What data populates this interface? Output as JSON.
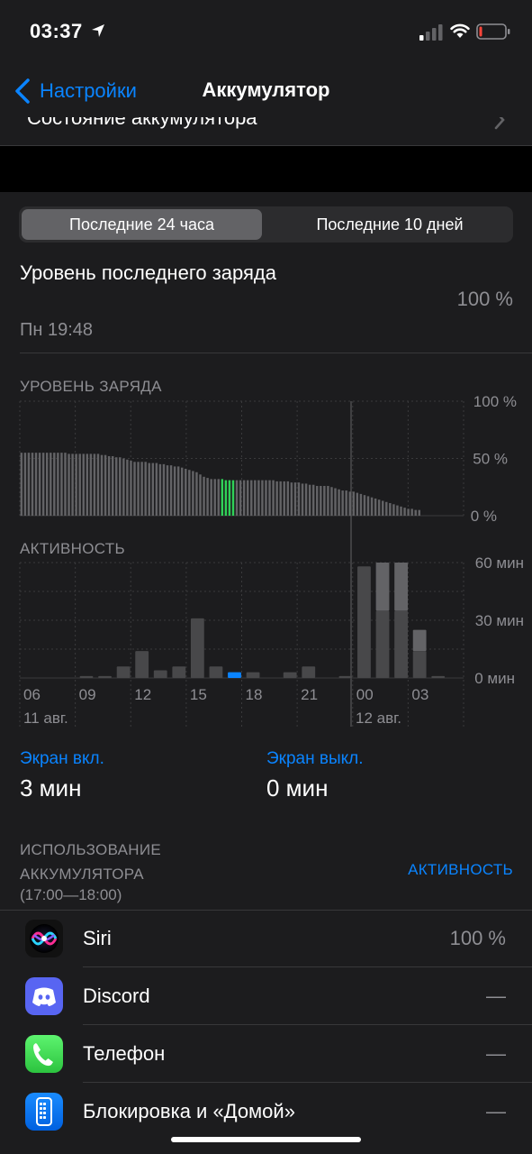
{
  "status_bar": {
    "time": "03:37",
    "location_icon": "location-arrow-icon",
    "signal_icon": "cellular-signal-icon",
    "wifi_icon": "wifi-icon",
    "battery_icon": "battery-low-icon",
    "battery_color": "#ff453a"
  },
  "nav": {
    "back_label": "Настройки",
    "title": "Аккумулятор",
    "accent": "#0a84ff"
  },
  "previous_row": {
    "label": "Состояние аккумулятора"
  },
  "segmented": {
    "options": [
      "Последние 24 часа",
      "Последние 10 дней"
    ],
    "selected": "Последние 24 часа"
  },
  "last_charge": {
    "title": "Уровень последнего заряда",
    "time": "Пн 19:48",
    "value": "100 %"
  },
  "battery_level": {
    "label": "УРОВЕНЬ ЗАРЯДА",
    "y_ticks": [
      "100 %",
      "50 %",
      "0 %"
    ]
  },
  "activity": {
    "label": "АКТИВНОСТЬ",
    "y_ticks": [
      "60 мин",
      "30 мин",
      "0 мин"
    ],
    "x_ticks": [
      "06",
      "09",
      "12",
      "15",
      "18",
      "21",
      "00",
      "03"
    ],
    "date_labels": [
      "11 авг.",
      "12 авг."
    ]
  },
  "chart_data": [
    {
      "type": "bar",
      "title": "УРОВЕНЬ ЗАРЯДА",
      "ylabel": "",
      "ylim": [
        0,
        100
      ],
      "y_ticks": [
        "100 %",
        "50 %",
        "0 %"
      ],
      "x_ticks": [
        "06",
        "09",
        "12",
        "15",
        "18",
        "21",
        "00",
        "03"
      ],
      "highlight_color": "#30d158",
      "bar_color": "#636366",
      "values": [
        55,
        55,
        55,
        55,
        55,
        55,
        55,
        55,
        55,
        55,
        55,
        55,
        55,
        54,
        54,
        54,
        54,
        54,
        54,
        54,
        54,
        54,
        53,
        53,
        52,
        52,
        51,
        51,
        50,
        49,
        48,
        47,
        47,
        47,
        47,
        46,
        46,
        46,
        45,
        45,
        44,
        44,
        43,
        43,
        42,
        41,
        40,
        39,
        38,
        36,
        34,
        33,
        32,
        32,
        32,
        32,
        31,
        31,
        31,
        31,
        31,
        31,
        31,
        31,
        31,
        31,
        31,
        31,
        31,
        31,
        30,
        30,
        30,
        30,
        29,
        29,
        29,
        28,
        28,
        27,
        27,
        26,
        26,
        26,
        26,
        25,
        24,
        23,
        22,
        22,
        21,
        21,
        20,
        19,
        18,
        17,
        16,
        15,
        14,
        13,
        12,
        11,
        10,
        9,
        8,
        7,
        6,
        6,
        5,
        5
      ],
      "highlight_range": [
        55,
        58
      ]
    },
    {
      "type": "bar",
      "title": "АКТИВНОСТЬ",
      "ylabel": "",
      "ylim": [
        0,
        60
      ],
      "y_ticks": [
        "60 мин",
        "30 мин",
        "0 мин"
      ],
      "x_ticks": [
        "06",
        "09",
        "12",
        "15",
        "18",
        "21",
        "00",
        "03"
      ],
      "date_labels": [
        "11 авг.",
        "12 авг."
      ],
      "categories": [
        "05",
        "06",
        "07",
        "08",
        "09",
        "10",
        "11",
        "12",
        "13",
        "14",
        "15",
        "16",
        "17",
        "18",
        "19",
        "20",
        "21",
        "22",
        "23",
        "00",
        "01",
        "02",
        "03"
      ],
      "series": [
        {
          "name": "Экран вкл.",
          "values": [
            0,
            0,
            0,
            1,
            1,
            6,
            14,
            4,
            6,
            31,
            6,
            3,
            3,
            0,
            3,
            6,
            0,
            0,
            58,
            60,
            60,
            25,
            0
          ]
        },
        {
          "name": "Экран выкл.",
          "values": [
            0,
            0,
            0,
            0,
            0,
            0,
            0,
            0,
            0,
            0,
            0,
            0,
            0,
            0,
            0,
            0,
            0,
            0,
            0,
            0,
            0,
            0,
            0
          ]
        }
      ],
      "on_values": [
        0,
        0,
        0,
        1,
        1,
        6,
        14,
        4,
        6,
        31,
        6,
        3,
        3,
        0,
        3,
        6,
        0,
        1,
        58,
        35,
        35,
        14,
        1
      ],
      "off_values": [
        0,
        0,
        0,
        0,
        0,
        0,
        0,
        0,
        0,
        0,
        0,
        0,
        0,
        0,
        0,
        0,
        0,
        0,
        0,
        25,
        25,
        11,
        0
      ],
      "highlight_index": 11,
      "highlight_color": "#0a84ff",
      "bar_color": "#48484a",
      "bar_color_light": "#636366"
    }
  ],
  "screen": {
    "on_label": "Экран вкл.",
    "on_value": "3 мин",
    "off_label": "Экран выкл.",
    "off_value": "0 мин"
  },
  "usage": {
    "title": "ИСПОЛЬЗОВАНИЕ АККУМУЛЯТОРА",
    "range": "(17:00—18:00)",
    "toggle_label": "АКТИВНОСТЬ"
  },
  "apps": [
    {
      "name": "Siri",
      "value": "100 %",
      "icon": "siri-icon"
    },
    {
      "name": "Discord",
      "value": "—",
      "icon": "discord-icon"
    },
    {
      "name": "Телефон",
      "value": "—",
      "icon": "phone-icon"
    },
    {
      "name": "Блокировка и «Домой»",
      "value": "—",
      "icon": "lock-home-icon"
    }
  ]
}
